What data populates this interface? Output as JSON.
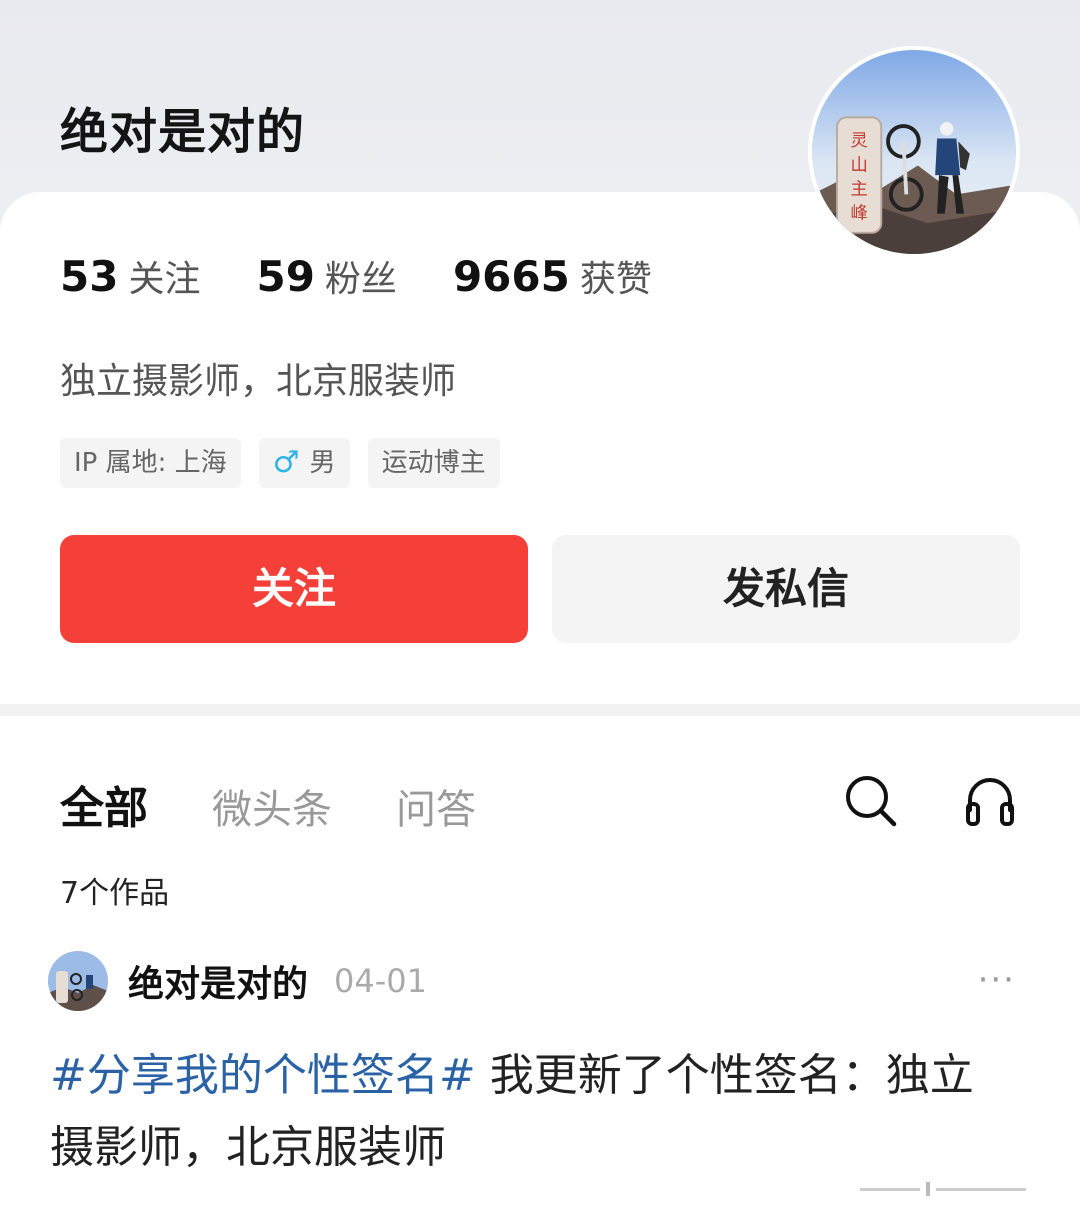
{
  "profile": {
    "name": "绝对是对的",
    "stats": [
      {
        "num": "53",
        "label": "关注"
      },
      {
        "num": "59",
        "label": "粉丝"
      },
      {
        "num": "9665",
        "label": "获赞"
      }
    ],
    "bio": "独立摄影师，北京服装师",
    "tags": {
      "ip": "IP 属地: 上海",
      "gender_icon": "♂",
      "gender": "男",
      "category": "运动博主"
    },
    "avatar_sign_text": "灵山主峰"
  },
  "actions": {
    "follow": "关注",
    "message": "发私信"
  },
  "tabs": [
    {
      "label": "全部",
      "active": true
    },
    {
      "label": "微头条",
      "active": false
    },
    {
      "label": "问答",
      "active": false
    }
  ],
  "works_count": "7个作品",
  "post": {
    "author": "绝对是对的",
    "date": "04-01",
    "more": "···",
    "hashtag": "#分享我的个性签名#",
    "text": " 我更新了个性签名：独立摄影师，北京服装师"
  },
  "colors": {
    "accent_red": "#f44038",
    "hashtag_blue": "#2b62a6",
    "gender_blue": "#2fb4e8"
  }
}
